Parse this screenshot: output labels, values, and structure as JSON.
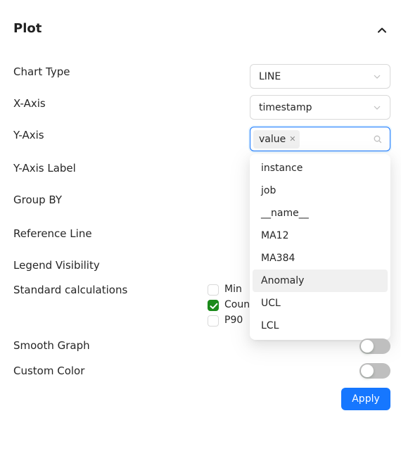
{
  "panel": {
    "title": "Plot"
  },
  "fields": {
    "chart_type": {
      "label": "Chart Type",
      "value": "LINE"
    },
    "x_axis": {
      "label": "X-Axis",
      "value": "timestamp"
    },
    "y_axis": {
      "label": "Y-Axis",
      "tags": [
        "value"
      ]
    },
    "y_axis_label": {
      "label": "Y-Axis Label"
    },
    "group_by": {
      "label": "Group BY"
    },
    "reference_line": {
      "label": "Reference Line"
    },
    "legend_visibility": {
      "label": "Legend Visibility"
    },
    "standard_calculations": {
      "label": "Standard calculations",
      "options": [
        {
          "label": "Min",
          "checked": false
        },
        {
          "label": "Count",
          "checked": true
        },
        {
          "label": "P90",
          "checked": false
        }
      ]
    },
    "smooth_graph": {
      "label": "Smooth Graph",
      "on": false
    },
    "custom_color": {
      "label": "Custom Color",
      "on": false
    }
  },
  "y_axis_dropdown": {
    "options": [
      "instance",
      "job",
      "__name__",
      "MA12",
      "MA384",
      "Anomaly",
      "UCL",
      "LCL"
    ],
    "highlighted": "Anomaly"
  },
  "apply_label": "Apply",
  "colors": {
    "primary": "#1677ff",
    "checkbox_checked": "#1a8a1a",
    "toggle_off": "#bfbfbf"
  }
}
